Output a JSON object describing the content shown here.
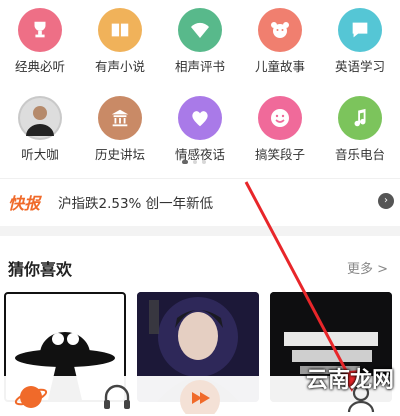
{
  "grid": {
    "row1": [
      {
        "label": "经典必听",
        "icon": "trophy-icon",
        "color": "#ee6f86"
      },
      {
        "label": "有声小说",
        "icon": "book-icon",
        "color": "#f0b25a"
      },
      {
        "label": "相声评书",
        "icon": "fan-icon",
        "color": "#58b98b"
      },
      {
        "label": "儿童故事",
        "icon": "bear-icon",
        "color": "#f07f6f"
      },
      {
        "label": "英语学习",
        "icon": "abc-icon",
        "color": "#55c6d5"
      }
    ],
    "row2": [
      {
        "label": "听大咖",
        "icon": "avatar-icon",
        "color": "#c9c9c9"
      },
      {
        "label": "历史讲坛",
        "icon": "temple-icon",
        "color": "#c98a66"
      },
      {
        "label": "情感夜话",
        "icon": "heart-icon",
        "color": "#a97ae8"
      },
      {
        "label": "搞笑段子",
        "icon": "smile-icon",
        "color": "#f06a9a"
      },
      {
        "label": "音乐电台",
        "icon": "music-icon",
        "color": "#7cc45c"
      }
    ]
  },
  "news": {
    "tag": "快报",
    "text": "沪指跌2.53% 创一年新低"
  },
  "recommend": {
    "title": "猜你喜欢",
    "more": "更多 >",
    "cards": [
      {
        "label": "ufo-cover"
      },
      {
        "label": "novel-cover"
      },
      {
        "label": "black-cover"
      }
    ]
  },
  "tabs": [
    "planet-icon",
    "headphones-icon",
    "play-icon",
    "user-icon"
  ],
  "watermark": "云南龙网",
  "colors": {
    "accent": "#f06a2a",
    "annotation": "#e8262a"
  }
}
